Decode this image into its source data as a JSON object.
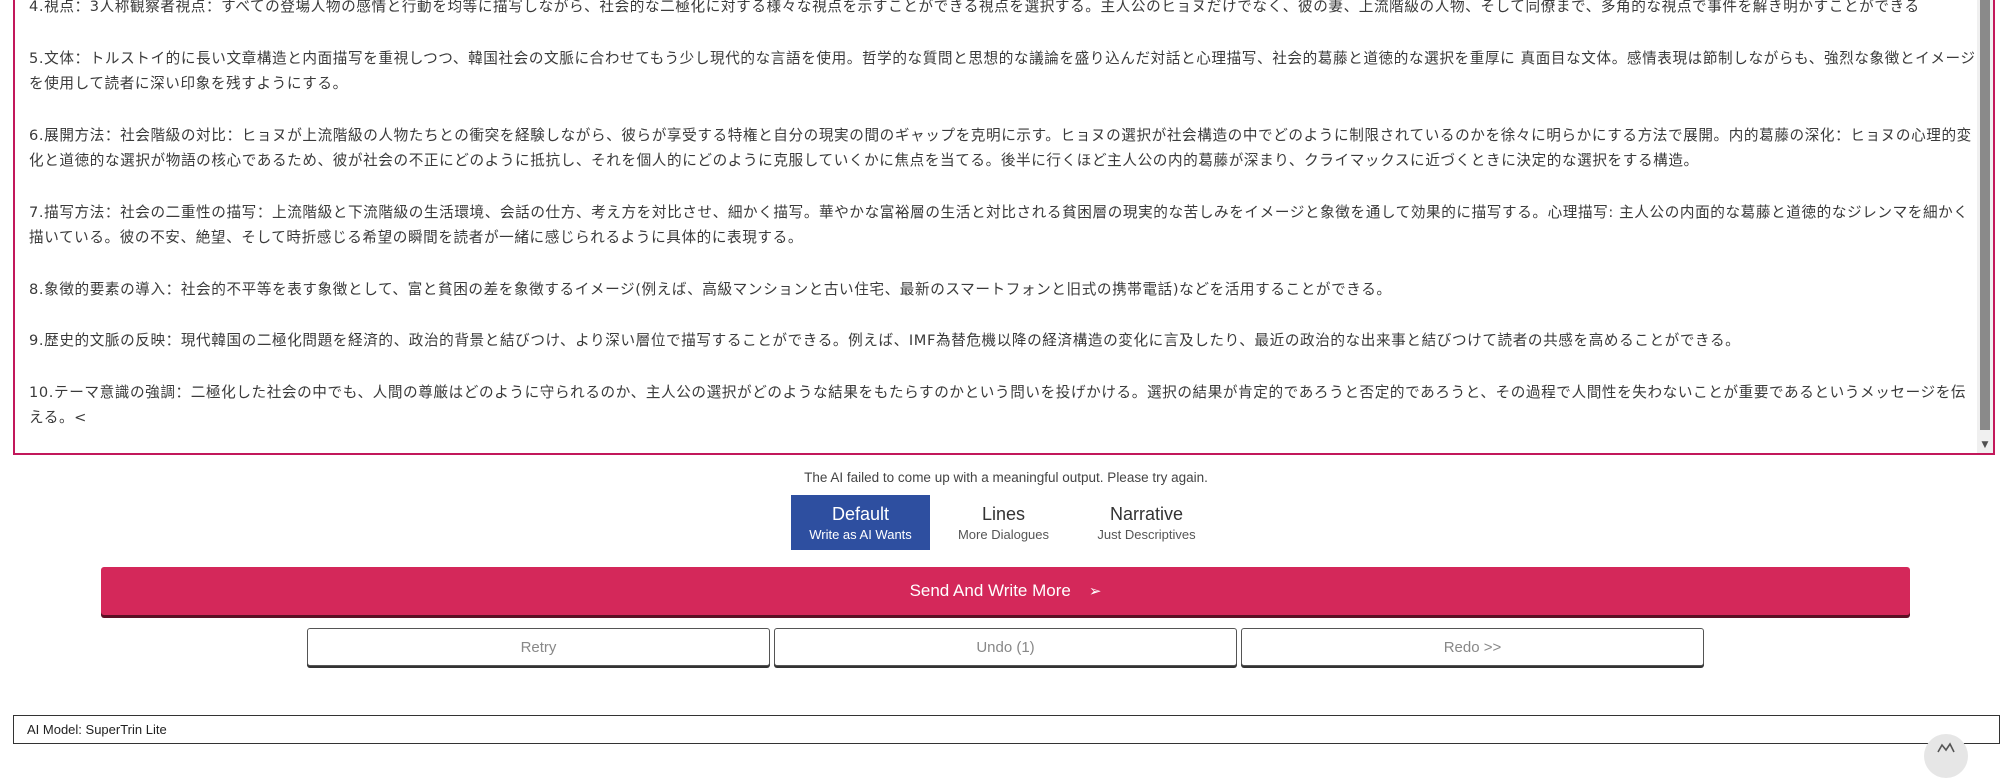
{
  "editor": {
    "paragraphs": [
      "4.視点：3人称観察者視点：すべての登場人物の感情と行動を均等に描写しながら、社会的な二極化に対する様々な視点を示すことができる視点を選択する。主人公のヒョヌだけでなく、彼の妻、上流階級の人物、そして同僚まで、多角的な視点で事件を解き明かすことができる",
      "5.文体：トルストイ的に長い文章構造と内面描写を重視しつつ、韓国社会の文脈に合わせてもう少し現代的な言語を使用。哲学的な質問と思想的な議論を盛り込んだ対話と心理描写、社会的葛藤と道徳的な選択を重厚に 真面目な文体。感情表現は節制しながらも、強烈な象徴とイメージを使用して読者に深い印象を残すようにする。",
      "6.展開方法：社会階級の対比：ヒョヌが上流階級の人物たちとの衝突を経験しながら、彼らが享受する特権と自分の現実の間のギャップを克明に示す。ヒョヌの選択が社会構造の中でどのように制限されているのかを徐々に明らかにする方法で展開。内的葛藤の深化：ヒョヌの心理的変化と道徳的な選択が物語の核心であるため、彼が社会の不正にどのように抵抗し、それを個人的にどのように克服していくかに焦点を当てる。後半に行くほど主人公の内的葛藤が深まり、クライマックスに近づくときに決定的な選択をする構造。",
      "7.描写方法：社会の二重性の描写：上流階級と下流階級の生活環境、会話の仕方、考え方を対比させ、細かく描写。華やかな富裕層の生活と対比される貧困層の現実的な苦しみをイメージと象徴を通して効果的に描写する。心理描写: 主人公の内面的な葛藤と道徳的なジレンマを細かく描いている。彼の不安、絶望、そして時折感じる希望の瞬間を読者が一緒に感じられるように具体的に表現する。",
      "8.象徴的要素の導入：社会的不平等を表す象徴として、富と貧困の差を象徴するイメージ(例えば、高級マンションと古い住宅、最新のスマートフォンと旧式の携帯電話)などを活用することができる。",
      "9.歴史的文脈の反映：現代韓国の二極化問題を経済的、政治的背景と結びつけ、より深い層位で描写することができる。例えば、IMF為替危機以降の経済構造の変化に言及したり、最近の政治的な出来事と結びつけて読者の共感を高めることができる。",
      "10.テーマ意識の強調：二極化した社会の中でも、人間の尊厳はどのように守られるのか、主人公の選択がどのような結果をもたらすのかという問いを投げかける。選択の結果が肯定的であろうと否定的であろうと、その過程で人間性を失わないことが重要であるというメッセージを伝える。<"
    ]
  },
  "status": {
    "message": "The AI failed to come up with a meaningful output. Please try again."
  },
  "modes": [
    {
      "title": "Default",
      "subtitle": "Write as AI Wants",
      "active": true
    },
    {
      "title": "Lines",
      "subtitle": "More Dialogues",
      "active": false
    },
    {
      "title": "Narrative",
      "subtitle": "Just Descriptives",
      "active": false
    }
  ],
  "actions": {
    "send_label": "Send And Write More",
    "send_icon": "➢",
    "retry_label": "Retry",
    "undo_label": "Undo (1)",
    "redo_label": "Redo >>"
  },
  "model": {
    "label": "AI Model: SuperTrin Lite"
  },
  "colors": {
    "accent": "#d4285a",
    "mode_active": "#2e4fa0",
    "editor_border": "#c2185b"
  },
  "icons": {
    "scroll_down": "scroll-down-arrow-icon",
    "send": "send-arrow-icon",
    "corner": "chat-widget-icon"
  }
}
